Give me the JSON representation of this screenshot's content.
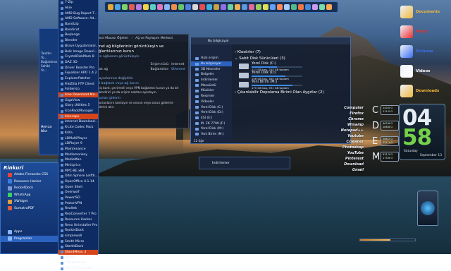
{
  "programs": [
    "7-Zip",
    "Akie",
    "AMD Bug Report T...",
    "AMD Software: Ad...",
    "Bandizip",
    "Bandicut",
    "Beşlenge",
    "Blender",
    "Brave Uygulamalar...",
    "Bulk Image Downl...",
    "CrystalDiskMark 8",
    "DAZ 3D",
    "Driver Booster Pro",
    "Equalizer APO 1.4.2",
    "ExplorerPatcher",
    "FileZilla FTP Client",
    "Folderico",
    "Free Download Ma...",
    "GigaView",
    "Glary Utilities 5",
    "IconPackManager",
    "Inkscape",
    "Internet Download...",
    "K-Lite Codec Pack",
    "Krita",
    "LDMultiPlayer",
    "LDPlayer 9",
    "Maintenance",
    "Mediamonkey",
    "MediaMan",
    "MiniLyrics",
    "MPC-BE x64",
    "Odin Sphere Leifth...",
    "OpenOffice 4.1.14",
    "Open Shell",
    "Overwolf",
    "PowerISO",
    "ProtonVPN",
    "Realtek",
    "ReaConverter 7 Pro",
    "Resource Hacker",
    "Revo Uninstaller Pro",
    "RocketDock",
    "simplewall",
    "Smith Micro",
    "StartIsBack",
    "StandMenu 3",
    "Steam",
    "TAP-Windows",
    "Total Commander"
  ],
  "highlighted_programs": [
    "Free Download Ma...",
    "Inkscape",
    "StandMenu 3"
  ],
  "left_panel": {
    "title": "Rinkuri",
    "items": [
      "Adobe Fireworks CS5",
      "Resource Hacker",
      "RocketDock",
      "WhatsApp",
      "XWidget",
      "SumatraPDF"
    ],
    "bottom_items": [
      "Apps",
      "Programlar"
    ]
  },
  "strip": {
    "user": "Tanıtkn Yo...",
    "line2": "Bağlantınız",
    "line3": "Sahibi Yo...",
    "footer": "Ayrıca bkz"
  },
  "network_window": {
    "tabs": [
      "Kontrol Masası Öğeleri",
      "Ağ ve Paylaşım Merkezi"
    ],
    "heading": "Temel ağ bilgilerinizi görüntüleyin ve bağlantılarınızı kurun",
    "active_label": "Etkin ağlarınızı görüntüleyin",
    "network_name": "Ağ",
    "public": "Ortak ağ",
    "access_label": "Erişim türü:",
    "access_value": "Internet",
    "connections_label": "Bağlantılar:",
    "connections_value": "Ethernet",
    "change_label": "Ağ ayarlarınızı değiştirin",
    "new_conn": "Yeni bağlantı veya ağ kurun",
    "new_conn_desc": "Geniş bant, çevirmeli veya VPN bağlantısı kurun ya da bir yönlendirici ya da erişim noktası ayarlayın.",
    "troubleshoot": "Sorunları giderin",
    "troubleshoot_desc": "Ağ sorunlarını tanılayın ve onarın veya sorun giderme bilgilerini alın."
  },
  "explorer": {
    "title": "Bu bilgisayar",
    "nav": [
      "Hızlı erişim",
      "Bu bilgisayar",
      "3D Nesneler",
      "Belgeler",
      "Indirilenler",
      "Masaüstü",
      "Müzikler",
      "Resimler",
      "Videolar",
      "Yerel Disk (C:)",
      "Yerel Disk (D:)",
      "ESI (E:)",
      "M. CK 7790 (F:)",
      "Yerel Disk (M:)",
      "Yeni Birim (M:)"
    ],
    "selected_nav": "Bu bilgisayar",
    "folders_label": "Klasörler (7)",
    "drives_label": "Sabit Disk Sürücüleri (3)",
    "drives": [
      {
        "name": "Yerel Disk (C:)",
        "info": "111 GB boş, 223 GB toplam",
        "used": 0.5
      },
      {
        "name": "Yerel Disk (D:)",
        "info": "156 GB boş, 465 GB toplam",
        "used": 0.66
      },
      {
        "name": "Yeni Birim (M:)",
        "info": "175 GB boş, 931 GB toplam",
        "used": 0.81
      }
    ],
    "removable_label": "Çıkarılabilir Depolama Birimi Olan Aygıtlar (2)",
    "items_count": "12 öğe"
  },
  "downloads_window": {
    "title": "İndirilenler"
  },
  "desktop_icons": [
    {
      "label": "Documents",
      "icon": "documents-icon",
      "color": "#f2b73a"
    },
    {
      "label": "Music",
      "icon": "music-icon",
      "color": "#ee2d2d"
    },
    {
      "label": "Pictures",
      "icon": "pictures-icon",
      "color": "#3a6ef2"
    },
    {
      "label": "Videos",
      "icon": "videos-icon",
      "color": "#ffffff"
    },
    {
      "label": "Downloads",
      "icon": "downloads-icon",
      "color": "#f2b73a"
    }
  ],
  "launcher": [
    "Computer",
    "Firefox",
    "Chrome",
    "Winamp",
    "Notepad++",
    "Youtube",
    "Ccleaner",
    "Photoshop",
    "YouTube",
    "Pinterest",
    "Download",
    "Gmail"
  ],
  "drives_gauge": [
    {
      "letter": "C",
      "a": "240.0 G",
      "b": "111.0 G"
    },
    {
      "letter": "D",
      "a": "465.6 G",
      "b": "286.8 G"
    },
    {
      "letter": "E",
      "a": "286.2 G",
      "b": "121.1 G"
    },
    {
      "letter": "M",
      "a": "931.5 G",
      "b": "175.6 G"
    }
  ],
  "clock": {
    "hours": "04",
    "minutes": "58",
    "day": "Saturday",
    "date": "September 13"
  },
  "volume": {
    "level": 0.55
  }
}
